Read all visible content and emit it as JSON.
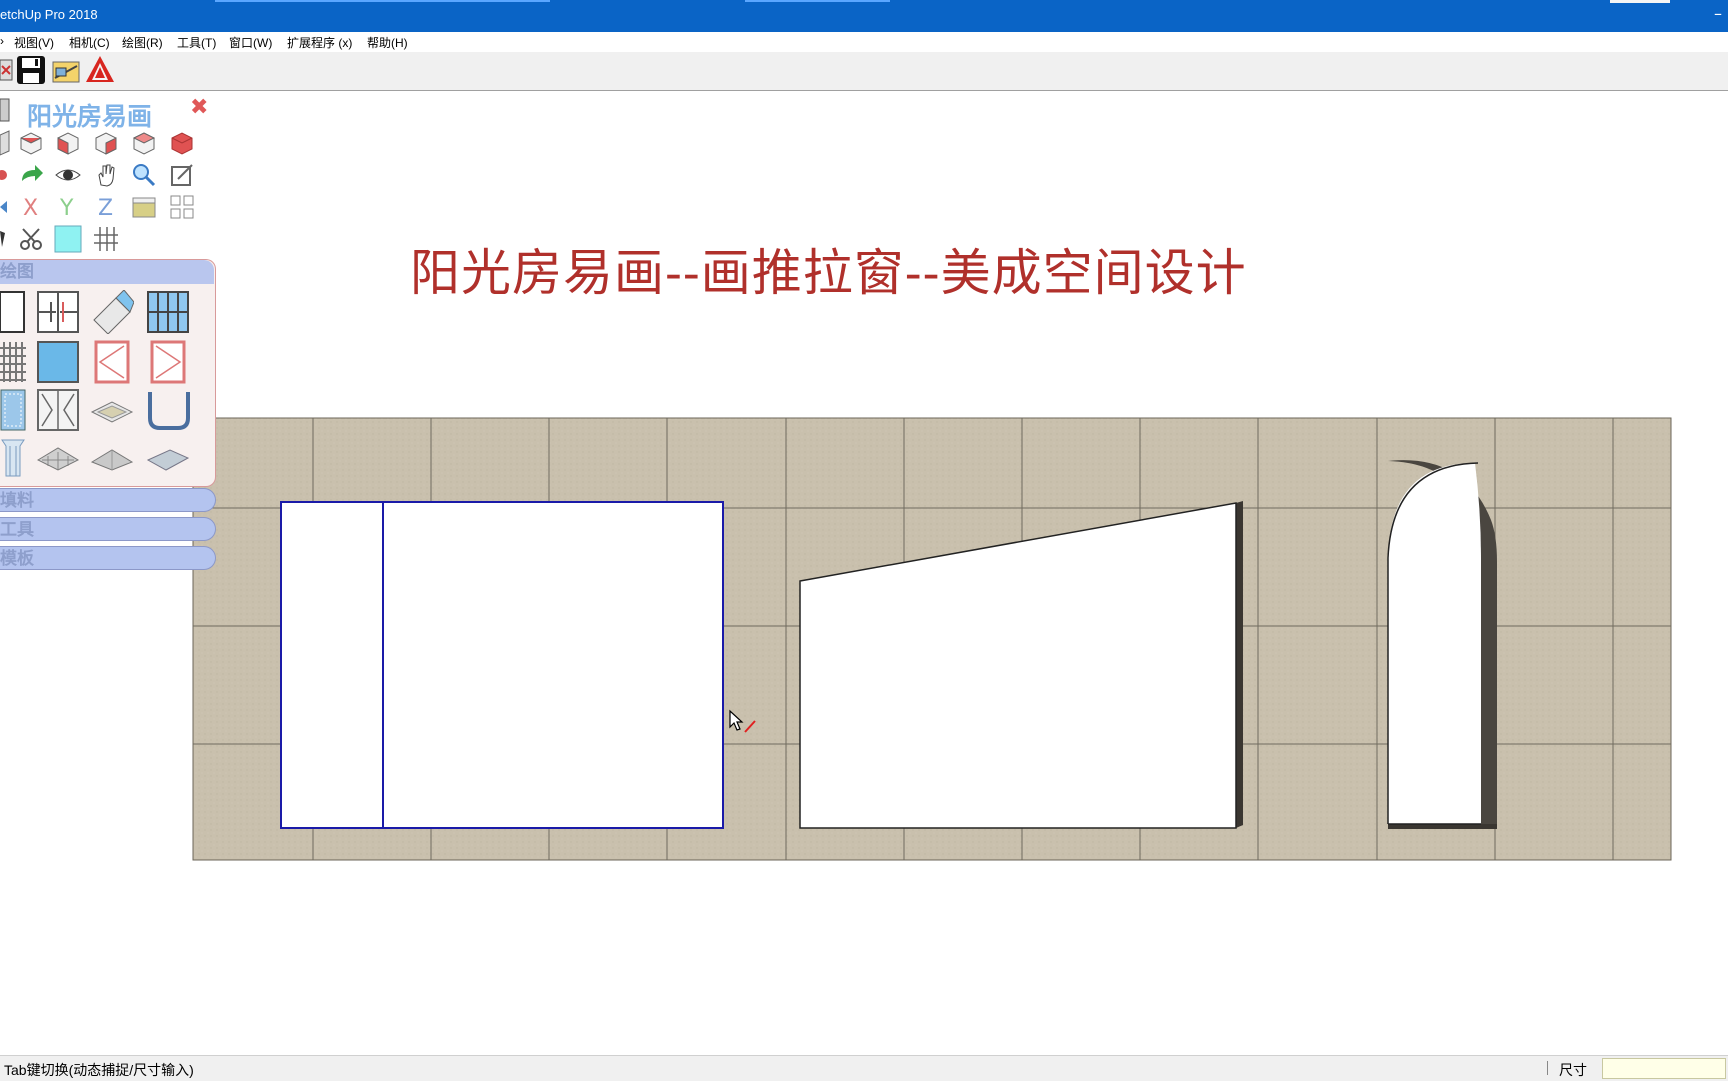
{
  "window": {
    "title": "etchUp Pro 2018",
    "minimize_glyph": "–"
  },
  "menu": {
    "items": [
      {
        "label": "视图(V)"
      },
      {
        "label": "相机(C)"
      },
      {
        "label": "绘图(R)"
      },
      {
        "label": "工具(T)"
      },
      {
        "label": "窗口(W)"
      },
      {
        "label": "扩展程序 (x)"
      },
      {
        "label": "帮助(H)"
      }
    ]
  },
  "toolbar": {
    "buttons": [
      "resize-icon",
      "save-icon",
      "sketch-icon",
      "layout-icon"
    ]
  },
  "plugin_panel": {
    "logo": "阳光房易画",
    "close": "✖",
    "sections": {
      "draw": "绘图",
      "materials": "填料",
      "tools": "工具",
      "templates": "模板"
    },
    "colors": {
      "section_bg": "#b4c4ef",
      "draw_border": "#d89a9a",
      "logo": "#7fb3e8"
    }
  },
  "viewport": {
    "title": "阳光房易画--画推拉窗--美成空间设计",
    "title_color": "#b0302b",
    "wall_color": "#c9c0ad",
    "selection_color": "#1a1aa8"
  },
  "status": {
    "hint": "Tab键切换(动态捕捉/尺寸输入)",
    "measurement_label": "尺寸",
    "measurement_value": ""
  }
}
